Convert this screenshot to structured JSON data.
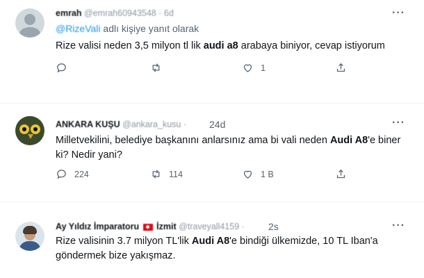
{
  "tweets": [
    {
      "author_name": "emrah",
      "author_handle": "@emrah60943548",
      "time_sep": "·",
      "time": "6d",
      "reply_prefix": "",
      "reply_mention": "@RizeVali",
      "reply_suffix": " adlı kişiye yanıt olarak",
      "text_parts": [
        "Rize valisi neden 3,5 milyon tl lik ",
        "audi a8",
        " arabaya biniyor, cevap istiyorum"
      ],
      "reply_count": "",
      "retweet_count": "",
      "like_count": "1",
      "more_label": "···",
      "avatar": "default-avatar-icon"
    },
    {
      "author_name": "ANKARA KUŞU",
      "author_handle": "@ankara_kusu",
      "time_sep": "·",
      "time": "24d",
      "text_parts": [
        "Milletvekilini, belediye başkanını anlarsınız ama bi vali neden ",
        "Audi A8",
        "'e biner ki? Nedir yani?"
      ],
      "reply_count": "224",
      "retweet_count": "114",
      "like_count": "1 B",
      "more_label": "···",
      "avatar": "owl-avatar-icon"
    },
    {
      "author_name": "Ay Yıldız İmparatoru",
      "author_name_suffix": "İzmit",
      "author_handle": "@traveyall4159",
      "time_sep": "·",
      "time": "2s",
      "text_parts": [
        "Rize valisinin 3.7 milyon TL'lik ",
        "Audi A8",
        "'e bindiği ülkemizde, 10 TL Iban'a göndermek bize yakışmaz."
      ],
      "more_label": "···",
      "avatar": "person-avatar-icon"
    }
  ]
}
